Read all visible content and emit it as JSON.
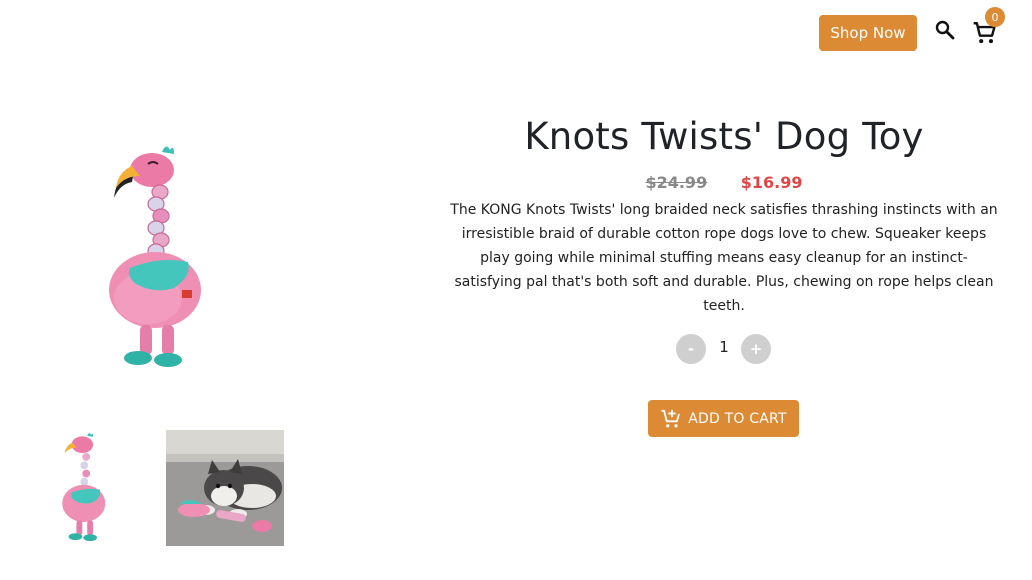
{
  "header": {
    "shop_now_label": "Shop Now",
    "cart_count": "0",
    "icons": {
      "search": "search-icon",
      "cart": "cart-icon"
    },
    "accent_color": "#dc8a33"
  },
  "product": {
    "title": "Knots Twists' Dog Toy",
    "old_price": "$24.99",
    "new_price": "$16.99",
    "price_color": "#e04646",
    "description": "The KONG Knots Twists' long braided neck satisfies thrashing instincts with an irresistible braid of durable cotton rope dogs love to chew. Squeaker keeps play going while minimal stuffing means easy cleanup for an instinct-satisfying pal that's both soft and durable. Plus, chewing on rope helps clean teeth.",
    "images": {
      "main": "pink flamingo rope dog toy",
      "thumbnails": [
        "pink flamingo rope dog toy",
        "husky puppy chewing flamingo toy"
      ]
    }
  },
  "quantity": {
    "minus_label": "-",
    "value": "1",
    "plus_label": "+"
  },
  "cart_button": {
    "label": "ADD TO CART",
    "icon": "add-shopping-cart-icon"
  }
}
